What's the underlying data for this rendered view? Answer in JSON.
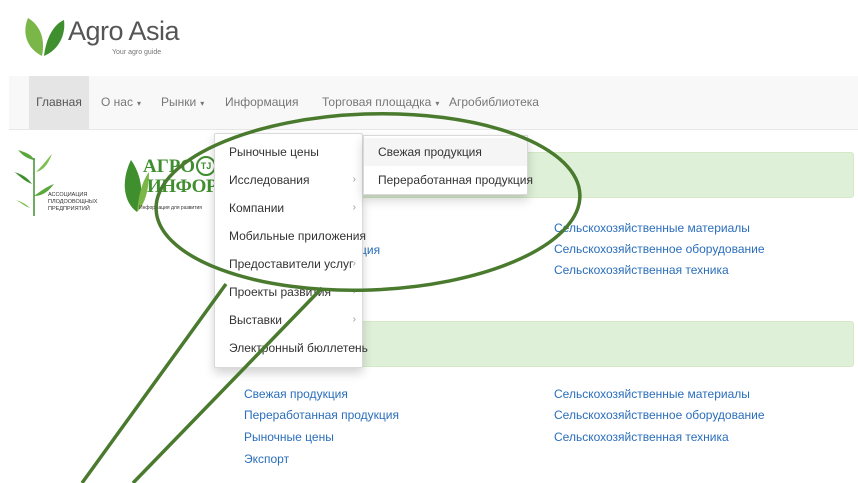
{
  "header": {
    "brand": "Agro Asia",
    "tagline": "Your agro guide"
  },
  "nav": {
    "items": [
      {
        "label": "Главная",
        "active": true
      },
      {
        "label": "О нас",
        "caret": "▾"
      },
      {
        "label": "Рынки",
        "caret": "▾"
      },
      {
        "label": "Информация"
      },
      {
        "label": "Торговая площадка",
        "caret": "▾"
      },
      {
        "label": "Агробиблиотека"
      }
    ]
  },
  "partners": {
    "assoc_text": "Ассоциация плодоовощных предприятий",
    "agro_word": "АГРО",
    "agro_tj": "TJ",
    "agro_inform": "ИНФОРМ",
    "agro_sub": "Информация для развития"
  },
  "dropdown": {
    "items": [
      {
        "label": "Рыночные цены"
      },
      {
        "label": "Исследования",
        "arrow": "›"
      },
      {
        "label": "Компании",
        "arrow": "›"
      },
      {
        "label": "Мобильные приложения",
        "arrow": "›"
      },
      {
        "label": "Предоставители услуг",
        "arrow": "›"
      },
      {
        "label": "Проекты развития",
        "arrow": "›"
      },
      {
        "label": "Выставки",
        "arrow": "›"
      },
      {
        "label": "Электронный бюллетень",
        "arrow": "›"
      }
    ],
    "submenu": [
      {
        "label": "Свежая продукция"
      },
      {
        "label": "Переработанная продукция"
      }
    ]
  },
  "section1": {
    "partial_left": "ция",
    "right_links": [
      "Сельскохозяйственные материалы",
      "Сельскохозяйственное оборудование",
      "Сельскохозяйственная техника"
    ]
  },
  "section2": {
    "left_links": [
      "Свежая продукция",
      "Переработанная продукция",
      "Рыночные цены",
      "Экспорт"
    ],
    "right_links": [
      "Сельскохозяйственные материалы",
      "Сельскохозяйственное оборудование",
      "Сельскохозяйственная техника"
    ]
  },
  "colors": {
    "accent_green": "#6aa84f",
    "link_blue": "#2a6ebb",
    "panel_green": "#dff0d8",
    "annotation_green": "#4a7a2e"
  }
}
